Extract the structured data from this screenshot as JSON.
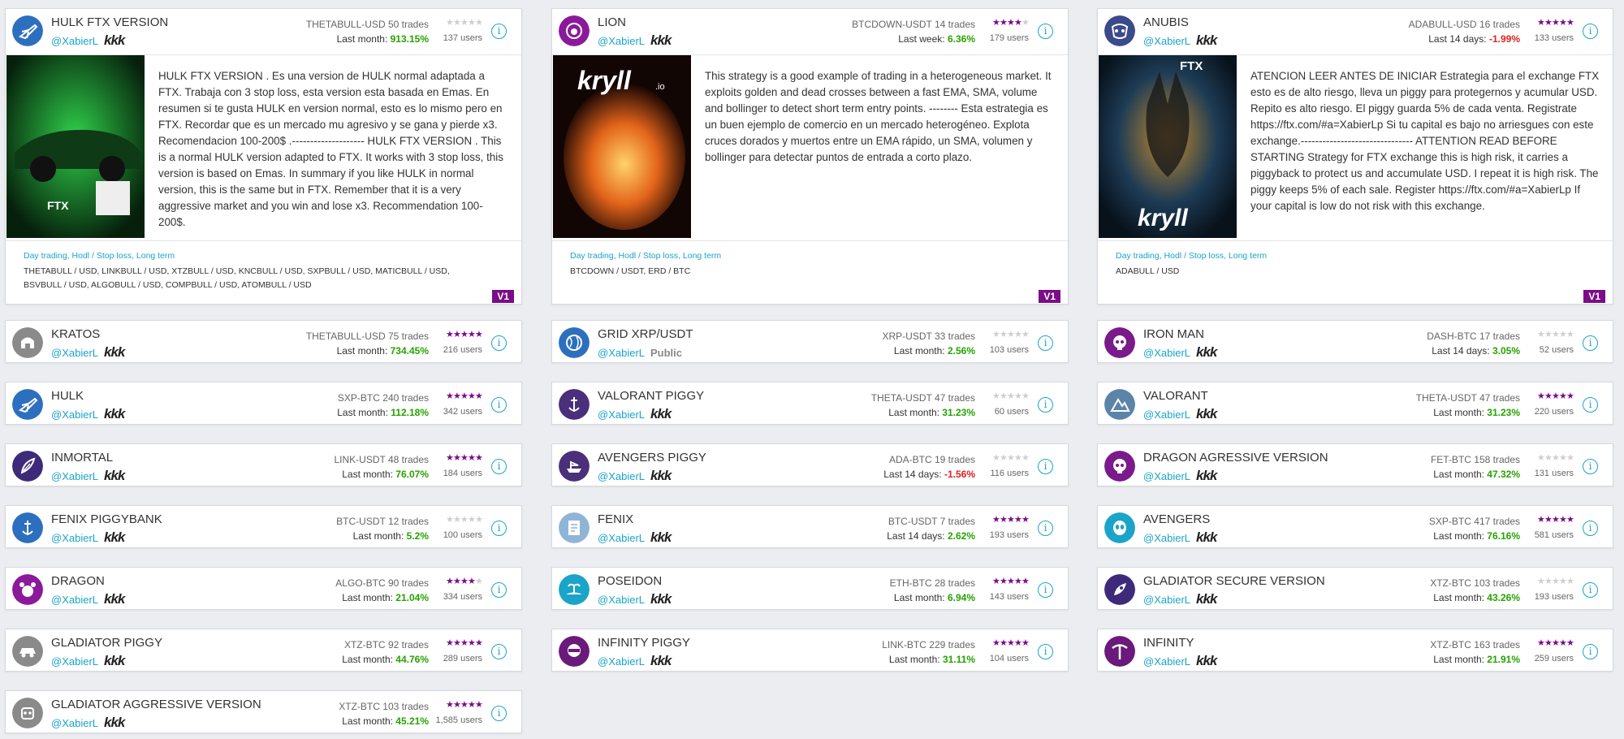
{
  "colors": {
    "accent": "#1aa4c9",
    "star": "#7a0d88",
    "positive": "#27a200",
    "negative": "#e02020",
    "badge": "#7a0d88"
  },
  "featured": [
    {
      "name": "HULK FTX VERSION",
      "author": "@XabierL",
      "brand": "kkk",
      "pair": "THETABULL-USD",
      "trades": "50 trades",
      "period": "Last month:",
      "pct": "913.15%",
      "sign": "pos",
      "rating": 0,
      "users": "137 users",
      "icon": "plane-icon",
      "iconColor": "#2d6fbf",
      "thumb": "car",
      "description": "HULK FTX VERSION . Es una version de HULK normal adaptada a FTX. Trabaja con 3 stop loss, esta version esta basada en Emas. En resumen si te gusta HULK en version normal, esto es lo mismo pero en FTX. Recordar que es un mercado mu agresivo y se gana y pierde x3. Recomendacion 100-200$ .-------------------- HULK FTX VERSION . This is a normal HULK version adapted to FTX. It works with 3 stop loss, this version is based on Emas. In summary if you like HULK in normal version, this is the same but in FTX. Remember that it is a very aggressive market and you win and lose x3. Recommendation 100-200$.",
      "tags": "Day trading, Hodl / Stop loss, Long term",
      "pairs": "THETABULL / USD, LINKBULL / USD, XTZBULL / USD, KNCBULL / USD, SXPBULL / USD, MATICBULL / USD, BSVBULL / USD, ALGOBULL / USD, COMPBULL / USD, ATOMBULL / USD",
      "version": "V1"
    },
    {
      "name": "LION",
      "author": "@XabierL",
      "brand": "kkk",
      "pair": "BTCDOWN-USDT",
      "trades": "14 trades",
      "period": "Last week:",
      "pct": "6.36%",
      "sign": "pos",
      "rating": 4,
      "users": "179 users",
      "icon": "lion-icon",
      "iconColor": "#8b1a9b",
      "thumb": "lion",
      "description": "This strategy is a good example of trading in a heterogeneous market. It exploits golden and dead crosses between a fast EMA, SMA, volume and bollinger to detect short term entry points. -------- Esta estrategia es un buen ejemplo de comercio en un mercado heterogéneo. Explota cruces dorados y muertos entre un EMA rápido, un SMA, volumen y bollinger para detectar puntos de entrada a corto plazo.",
      "tags": "Day trading, Hodl / Stop loss, Long term",
      "pairs": "BTCDOWN / USDT, ERD / BTC",
      "version": "V1"
    },
    {
      "name": "ANUBIS",
      "author": "@XabierL",
      "brand": "kkk",
      "pair": "ADABULL-USD",
      "trades": "16 trades",
      "period": "Last 14 days:",
      "pct": "-1.99%",
      "sign": "neg",
      "rating": 5,
      "users": "133 users",
      "icon": "mask-icon",
      "iconColor": "#3b4a8c",
      "thumb": "anubis",
      "description": "ATENCION LEER ANTES DE INICIAR Estrategia para el exchange FTX esto es de alto riesgo, lleva un piggy para protegernos y acumular USD. Repito es alto riesgo. El piggy guarda 5% de cada venta. Registrate https://ftx.com/#a=XabierLp Si tu capital es bajo no arriesgues con este exchange.------------------------------- ATTENTION READ BEFORE STARTING Strategy for FTX exchange this is high risk, it carries a piggyback to protect us and accumulate USD. I repeat it is high risk. The piggy keeps 5% of each sale. Register https://ftx.com/#a=XabierLp If your capital is low do not risk with this exchange.",
      "tags": "Day trading, Hodl / Stop loss, Long term",
      "pairs": "ADABULL / USD",
      "version": "V1"
    }
  ],
  "thumb_text": {
    "ftx": "FTX",
    "kryll": "kryll",
    "io": ".io"
  },
  "info_symbol": "i",
  "star_symbol": "★",
  "bots": [
    [
      {
        "name": "KRATOS",
        "author": "@XabierL",
        "brand": "kkk",
        "pair": "THETABULL-USD",
        "trades": "75 trades",
        "period": "Last month:",
        "pct": "734.45%",
        "sign": "pos",
        "rating": 5,
        "users": "216 users",
        "icon": "helmet-icon",
        "iconColor": "#8a8a8a"
      },
      {
        "name": "HULK",
        "author": "@XabierL",
        "brand": "kkk",
        "pair": "SXP-BTC",
        "trades": "240 trades",
        "period": "Last month:",
        "pct": "112.18%",
        "sign": "pos",
        "rating": 5,
        "users": "342 users",
        "icon": "plane-icon",
        "iconColor": "#2d6fbf"
      },
      {
        "name": "INMORTAL",
        "author": "@XabierL",
        "brand": "kkk",
        "pair": "LINK-USDT",
        "trades": "48 trades",
        "period": "Last month:",
        "pct": "76.07%",
        "sign": "pos",
        "rating": 5,
        "users": "184 users",
        "icon": "feather-icon",
        "iconColor": "#3d2a7a"
      },
      {
        "name": "FENIX PIGGYBANK",
        "author": "@XabierL",
        "brand": "kkk",
        "pair": "BTC-USDT",
        "trades": "12 trades",
        "period": "Last month:",
        "pct": "5.2%",
        "sign": "pos",
        "rating": 0,
        "users": "100 users",
        "icon": "anchor-icon",
        "iconColor": "#2d6fbf"
      },
      {
        "name": "DRAGON",
        "author": "@XabierL",
        "brand": "kkk",
        "pair": "ALGO-BTC",
        "trades": "90 trades",
        "period": "Last month:",
        "pct": "21.04%",
        "sign": "pos",
        "rating": 4,
        "users": "334 users",
        "icon": "bear-icon",
        "iconColor": "#8b1a9b"
      },
      {
        "name": "GLADIATOR PIGGY",
        "author": "@XabierL",
        "brand": "kkk",
        "pair": "XTZ-BTC",
        "trades": "92 trades",
        "period": "Last month:",
        "pct": "44.76%",
        "sign": "pos",
        "rating": 5,
        "users": "289 users",
        "icon": "car-icon",
        "iconColor": "#8a8a8a"
      },
      {
        "name": "GLADIATOR AGGRESSIVE VERSION",
        "author": "@XabierL",
        "brand": "kkk",
        "pair": "XTZ-BTC",
        "trades": "103 trades",
        "period": "Last month:",
        "pct": "45.21%",
        "sign": "pos",
        "rating": 4.5,
        "users": "1,585 users",
        "icon": "robot-icon",
        "iconColor": "#8a8a8a"
      }
    ],
    [
      {
        "name": "GRID XRP/USDT",
        "author": "@XabierL",
        "brand": "Public",
        "pair": "XRP-USDT",
        "trades": "33 trades",
        "period": "Last month:",
        "pct": "2.56%",
        "sign": "pos",
        "rating": 0,
        "users": "103 users",
        "icon": "globe-icon",
        "iconColor": "#2d6fbf"
      },
      {
        "name": "VALORANT PIGGY",
        "author": "@XabierL",
        "brand": "kkk",
        "pair": "THETA-USDT",
        "trades": "47 trades",
        "period": "Last month:",
        "pct": "31.23%",
        "sign": "pos",
        "rating": 0,
        "users": "60 users",
        "icon": "anchor-icon",
        "iconColor": "#4a2f7a"
      },
      {
        "name": "AVENGERS PIGGY",
        "author": "@XabierL",
        "brand": "kkk",
        "pair": "ADA-BTC",
        "trades": "19 trades",
        "period": "Last 14 days:",
        "pct": "-1.56%",
        "sign": "neg",
        "rating": 0,
        "users": "116 users",
        "icon": "ship-icon",
        "iconColor": "#4a2f7a"
      },
      {
        "name": "FENIX",
        "author": "@XabierL",
        "brand": "kkk",
        "pair": "BTC-USDT",
        "trades": "7 trades",
        "period": "Last 14 days:",
        "pct": "2.62%",
        "sign": "pos",
        "rating": 5,
        "users": "193 users",
        "icon": "document-icon",
        "iconColor": "#8fb4d6"
      },
      {
        "name": "POSEIDON",
        "author": "@XabierL",
        "brand": "kkk",
        "pair": "ETH-BTC",
        "trades": "28 trades",
        "period": "Last month:",
        "pct": "6.94%",
        "sign": "pos",
        "rating": 5,
        "users": "143 users",
        "icon": "island-icon",
        "iconColor": "#1aa4c9"
      },
      {
        "name": "INFINITY PIGGY",
        "author": "@XabierL",
        "brand": "kkk",
        "pair": "LINK-BTC",
        "trades": "229 trades",
        "period": "Last month:",
        "pct": "31.11%",
        "sign": "pos",
        "rating": 4.5,
        "users": "104 users",
        "icon": "ninja-icon",
        "iconColor": "#6a1a7a"
      }
    ],
    [
      {
        "name": "IRON MAN",
        "author": "@XabierL",
        "brand": "kkk",
        "pair": "DASH-BTC",
        "trades": "17 trades",
        "period": "Last 14 days:",
        "pct": "3.05%",
        "sign": "pos",
        "rating": 0,
        "users": "52 users",
        "icon": "skull-icon",
        "iconColor": "#7a1a8b"
      },
      {
        "name": "VALORANT",
        "author": "@XabierL",
        "brand": "kkk",
        "pair": "THETA-USDT",
        "trades": "47 trades",
        "period": "Last month:",
        "pct": "31.23%",
        "sign": "pos",
        "rating": 4.5,
        "users": "220 users",
        "icon": "mountain-icon",
        "iconColor": "#5b84a8"
      },
      {
        "name": "DRAGON AGRESSIVE VERSION",
        "author": "@XabierL",
        "brand": "kkk",
        "pair": "FET-BTC",
        "trades": "158 trades",
        "period": "Last month:",
        "pct": "47.32%",
        "sign": "pos",
        "rating": 0,
        "users": "131 users",
        "icon": "skull-icon",
        "iconColor": "#7a1a8b"
      },
      {
        "name": "AVENGERS",
        "author": "@XabierL",
        "brand": "kkk",
        "pair": "SXP-BTC",
        "trades": "417 trades",
        "period": "Last month:",
        "pct": "76.16%",
        "sign": "pos",
        "rating": 4.5,
        "users": "581 users",
        "icon": "alien-icon",
        "iconColor": "#1aa4c9"
      },
      {
        "name": "GLADIATOR SECURE VERSION",
        "author": "@XabierL",
        "brand": "kkk",
        "pair": "XTZ-BTC",
        "trades": "103 trades",
        "period": "Last month:",
        "pct": "43.26%",
        "sign": "pos",
        "rating": 0,
        "users": "193 users",
        "icon": "rocket-icon",
        "iconColor": "#3d2a7a"
      },
      {
        "name": "INFINITY",
        "author": "@XabierL",
        "brand": "kkk",
        "pair": "XTZ-BTC",
        "trades": "163 trades",
        "period": "Last month:",
        "pct": "21.91%",
        "sign": "pos",
        "rating": 5,
        "users": "259 users",
        "icon": "pickaxe-icon",
        "iconColor": "#6a1a7a"
      }
    ]
  ]
}
